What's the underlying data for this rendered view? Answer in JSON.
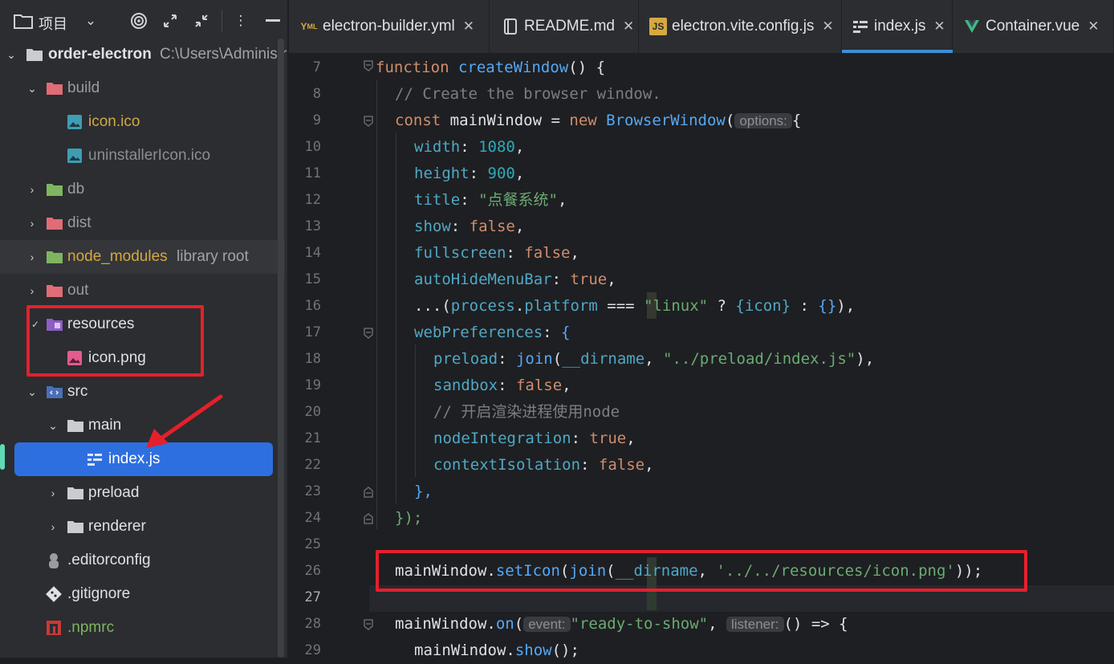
{
  "project_panel": {
    "title": "项目",
    "tree": [
      {
        "label": "order-electron",
        "note": "C:\\Users\\Administr"
      },
      {
        "label": "build"
      },
      {
        "label": "icon.ico"
      },
      {
        "label": "uninstallerIcon.ico"
      },
      {
        "label": "db"
      },
      {
        "label": "dist"
      },
      {
        "label": "node_modules",
        "note": "library root"
      },
      {
        "label": "out"
      },
      {
        "label": "resources"
      },
      {
        "label": "icon.png"
      },
      {
        "label": "src"
      },
      {
        "label": "main"
      },
      {
        "label": "index.js"
      },
      {
        "label": "preload"
      },
      {
        "label": "renderer"
      },
      {
        "label": ".editorconfig"
      },
      {
        "label": ".gitignore"
      },
      {
        "label": ".npmrc"
      }
    ]
  },
  "tabs": [
    {
      "label": "electron-builder.yml",
      "icon": "yaml-icon"
    },
    {
      "label": "README.md",
      "icon": "markdown-icon"
    },
    {
      "label": "electron.vite.config.js",
      "icon": "js-icon"
    },
    {
      "label": "index.js",
      "icon": "js-structure-icon",
      "active": true
    },
    {
      "label": "Container.vue",
      "icon": "vue-icon"
    }
  ],
  "editor": {
    "line_numbers": [
      "7",
      "8",
      "9",
      "10",
      "11",
      "12",
      "13",
      "14",
      "15",
      "16",
      "17",
      "18",
      "19",
      "20",
      "21",
      "22",
      "23",
      "24",
      "25",
      "26",
      "27",
      "28",
      "29"
    ],
    "inlay_hints": {
      "options": "options:",
      "event": "event:",
      "listener": "listener:"
    },
    "code": {
      "l7": {
        "kw": "function",
        "name": "createWindow",
        "rest": "() {"
      },
      "l8": "// Create the browser window.",
      "l9": {
        "kw1": "const",
        "var": "mainWindow",
        "eq": " = ",
        "kw2": "new",
        "cls": "BrowserWindow",
        "open": "(",
        "brace": "{"
      },
      "l10": {
        "prop": "width",
        "val": "1080"
      },
      "l11": {
        "prop": "height",
        "val": "900"
      },
      "l12": {
        "prop": "title",
        "val": "\"点餐系统\""
      },
      "l13": {
        "prop": "show",
        "val": "false"
      },
      "l14": {
        "prop": "fullscreen",
        "val": "false"
      },
      "l15": {
        "prop": "autoHideMenuBar",
        "val": "true"
      },
      "l16": {
        "spread": "...(",
        "obj": "process",
        "prop": "platform",
        "op": " === ",
        "str": "\"linux\"",
        "tern": " ? ",
        "a": "{icon}",
        "colon": " : ",
        "b": "{}",
        "end": "),"
      },
      "l17": {
        "prop": "webPreferences",
        "rest": "{"
      },
      "l18": {
        "prop": "preload",
        "fn": "join",
        "arg1": "__dirname",
        "arg2": "\"../preload/index.js\"",
        "end": "),"
      },
      "l19": {
        "prop": "sandbox",
        "val": "false"
      },
      "l20": "// 开启渲染进程使用node",
      "l21": {
        "prop": "nodeIntegration",
        "val": "true"
      },
      "l22": {
        "prop": "contextIsolation",
        "val": "false"
      },
      "l23": "},",
      "l24": "});",
      "l26": {
        "obj": "mainWindow",
        "method": "setIcon",
        "fn": "join",
        "arg1": "__dirname",
        "arg2": "'../../resources/icon.png'",
        "end": "));"
      },
      "l28": {
        "obj": "mainWindow",
        "method": "on",
        "str": "\"ready-to-show\"",
        "arrow": "() => {"
      },
      "l29": {
        "obj": "mainWindow",
        "method": "show",
        "end": "();"
      }
    }
  },
  "colors": {
    "highlight": "#e5202c",
    "selection": "#2e6fe0"
  }
}
